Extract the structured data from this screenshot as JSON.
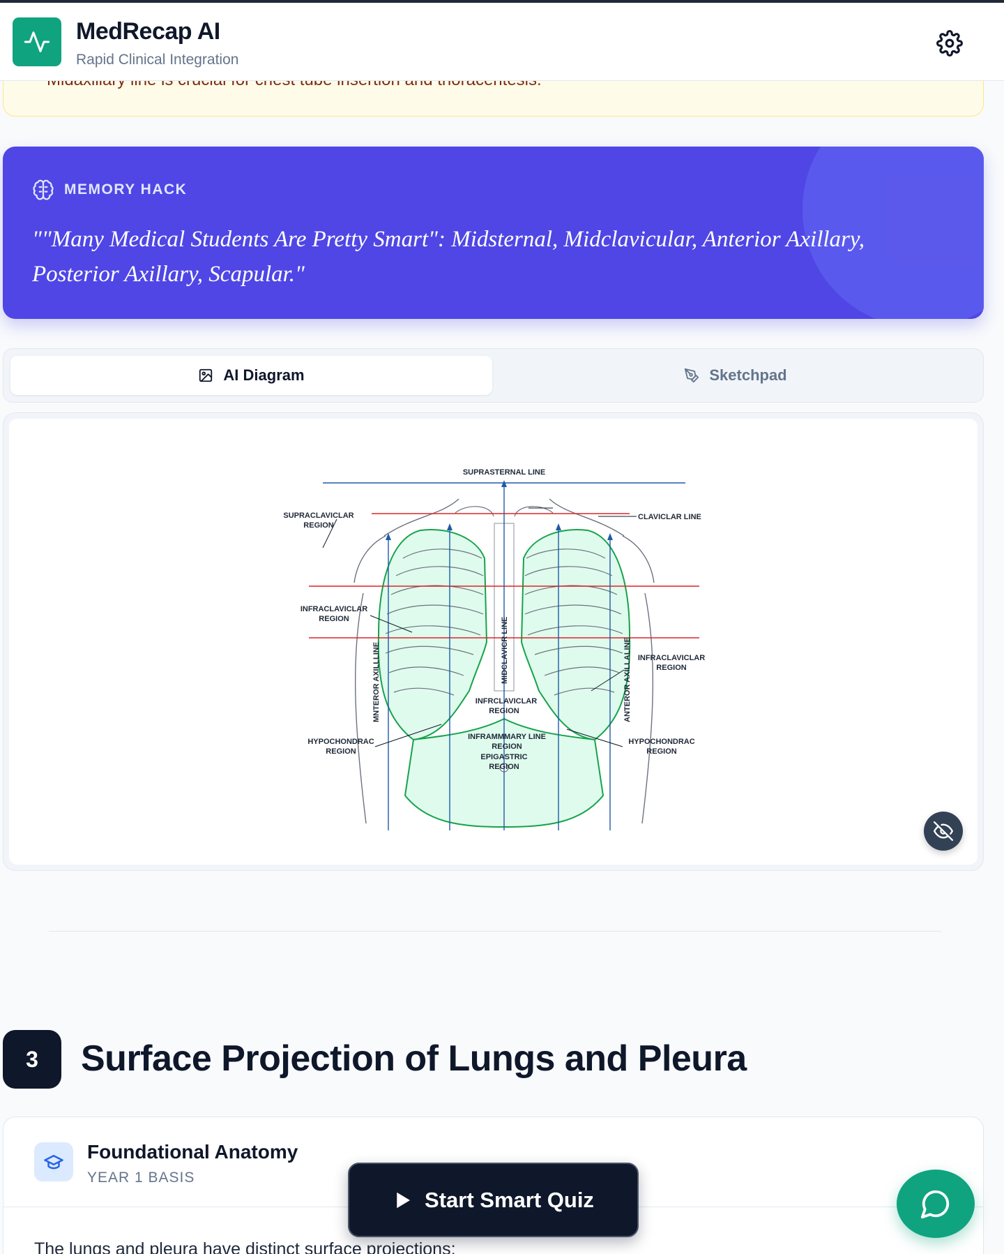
{
  "header": {
    "app_title": "MedRecap AI",
    "app_subtitle": "Rapid Clinical Integration",
    "logo_icon": "activity-pulse-icon",
    "settings_icon": "gear-icon"
  },
  "warning_card": {
    "text": "Midaxillary line is crucial for chest tube insertion and thoracentesis."
  },
  "memory_hack": {
    "label": "MEMORY HACK",
    "quote_line1": "\"\"Many Medical Students Are Pretty Smart\": Midsternal, Midclavicular, Anterior Axillary,",
    "quote_line2": "Posterior Axillary, Scapular.\""
  },
  "tabs": [
    {
      "label": "AI Diagram",
      "icon": "image-icon",
      "active": true
    },
    {
      "label": "Sketchpad",
      "icon": "pen-icon",
      "active": false
    }
  ],
  "diagram": {
    "labels": {
      "suprasternal": "SUPRASTERNAL LINE",
      "clavicular": "CLAVICLAR LINE",
      "supraclav_1": "SUPRACLAVICLAR",
      "supraclav_2": "REGION",
      "infraclav_l1": "INFRACLAVICLAR",
      "infraclav_l2": "REGION",
      "infraclav_r1": "INFRACLAVICLAR",
      "infraclav_r2": "REGION",
      "hypo_l1": "HYPOCHONDRAC",
      "hypo_l2": "REGION",
      "hypo_r1": "HYPOCHONDRAC",
      "hypo_r2": "REGION",
      "mnteror": "MNTEROR AXILLLINE",
      "anterior": "ANTEROR AXILLALINE",
      "midclavicr": "MIDCLAVICR LINE",
      "infrclav_1": "INFRCLAVICLAR",
      "infrclav_2": "REGION",
      "inframmary_1": "INFRAMMMARY LINE",
      "inframmary_2": "REGION",
      "epigastric_1": "EPIGASTRIC",
      "epigastric_2": "REGION"
    },
    "hide_icon": "eye-off-icon"
  },
  "section": {
    "number": "3",
    "title": "Surface Projection of Lungs and Pleura"
  },
  "foundational": {
    "icon": "graduation-cap-icon",
    "title": "Foundational Anatomy",
    "subtitle": "YEAR 1 BASIS",
    "body": "The lungs and pleura have distinct surface projections:"
  },
  "quiz_button": {
    "label": "Start Smart Quiz",
    "icon": "play-icon"
  },
  "chat_button": {
    "icon": "chat-bubble-icon"
  },
  "colors": {
    "brand": "#10a37f",
    "memory_bg": "#4f46e5",
    "dark": "#0f172a",
    "warning_bg": "#fefce8"
  }
}
